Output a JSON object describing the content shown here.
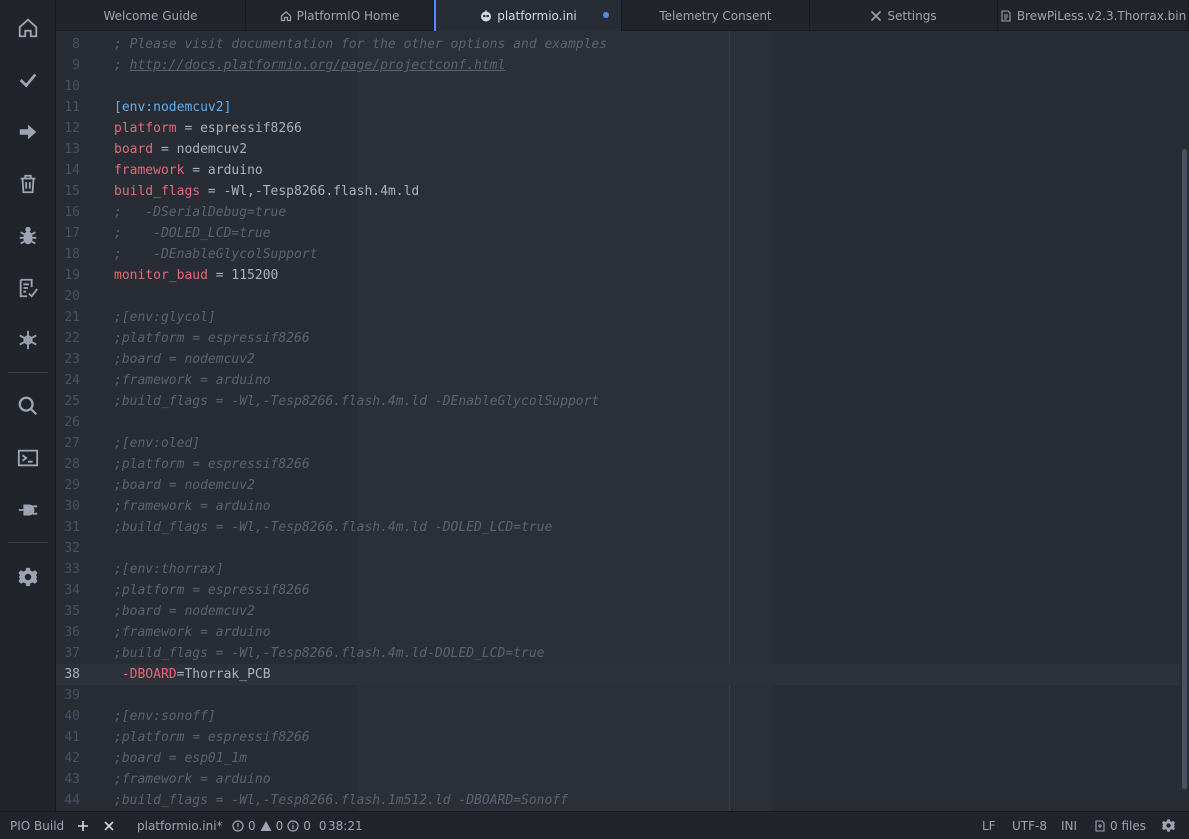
{
  "tabs": [
    {
      "label": "Welcome Guide",
      "icon": "",
      "active": false,
      "modified": false
    },
    {
      "label": "PlatformIO Home",
      "icon": "home-icon",
      "active": false,
      "modified": false
    },
    {
      "label": "platformio.ini",
      "icon": "alien-icon",
      "active": true,
      "modified": true
    },
    {
      "label": "Telemetry Consent",
      "icon": "",
      "active": false,
      "modified": false
    },
    {
      "label": "Settings",
      "icon": "tools-icon",
      "active": false,
      "modified": false
    },
    {
      "label": "BrewPiLess.v2.3.Thorrax.bin",
      "icon": "binary-file-icon",
      "active": false,
      "modified": false
    }
  ],
  "sidebar": {
    "items": [
      {
        "name": "home-icon"
      },
      {
        "name": "build-check-icon"
      },
      {
        "name": "upload-arrow-icon"
      },
      {
        "name": "clean-trash-icon"
      },
      {
        "name": "debug-bug-icon"
      },
      {
        "name": "test-checklist-icon"
      },
      {
        "name": "project-tasks-icon"
      },
      {
        "name": "search-icon"
      },
      {
        "name": "terminal-icon"
      },
      {
        "name": "serial-plug-icon"
      },
      {
        "name": "settings-gear-icon"
      }
    ]
  },
  "editor": {
    "cursor_line": 38,
    "lines": [
      {
        "n": "8",
        "parts": [
          [
            "comment",
            "; Please visit documentation for the other options and examples"
          ]
        ]
      },
      {
        "n": "9",
        "parts": [
          [
            "comment",
            "; "
          ],
          [
            "link",
            "http://docs.platformio.org/page/projectconf.html"
          ]
        ]
      },
      {
        "n": "10",
        "parts": []
      },
      {
        "n": "11",
        "parts": [
          [
            "section",
            "[env:nodemcuv2]"
          ]
        ]
      },
      {
        "n": "12",
        "parts": [
          [
            "key",
            "platform"
          ],
          [
            "text",
            " = espressif8266"
          ]
        ]
      },
      {
        "n": "13",
        "parts": [
          [
            "key",
            "board"
          ],
          [
            "text",
            " = nodemcuv2"
          ]
        ]
      },
      {
        "n": "14",
        "parts": [
          [
            "key",
            "framework"
          ],
          [
            "text",
            " = arduino"
          ]
        ]
      },
      {
        "n": "15",
        "parts": [
          [
            "key",
            "build_flags"
          ],
          [
            "text",
            " = -Wl,-Tesp8266.flash.4m.ld"
          ]
        ]
      },
      {
        "n": "16",
        "parts": [
          [
            "comment",
            ";   -DSerialDebug=true"
          ]
        ]
      },
      {
        "n": "17",
        "parts": [
          [
            "comment",
            ";    -DOLED_LCD=true"
          ]
        ]
      },
      {
        "n": "18",
        "parts": [
          [
            "comment",
            ";    -DEnableGlycolSupport"
          ]
        ]
      },
      {
        "n": "19",
        "parts": [
          [
            "key",
            "monitor_baud"
          ],
          [
            "text",
            " = 115200"
          ]
        ]
      },
      {
        "n": "20",
        "parts": []
      },
      {
        "n": "21",
        "parts": [
          [
            "comment",
            ";[env:glycol]"
          ]
        ]
      },
      {
        "n": "22",
        "parts": [
          [
            "comment",
            ";platform = espressif8266"
          ]
        ]
      },
      {
        "n": "23",
        "parts": [
          [
            "comment",
            ";board = nodemcuv2"
          ]
        ]
      },
      {
        "n": "24",
        "parts": [
          [
            "comment",
            ";framework = arduino"
          ]
        ]
      },
      {
        "n": "25",
        "parts": [
          [
            "comment",
            ";build_flags = -Wl,-Tesp8266.flash.4m.ld -DEnableGlycolSupport"
          ]
        ]
      },
      {
        "n": "26",
        "parts": []
      },
      {
        "n": "27",
        "parts": [
          [
            "comment",
            ";[env:oled]"
          ]
        ]
      },
      {
        "n": "28",
        "parts": [
          [
            "comment",
            ";platform = espressif8266"
          ]
        ]
      },
      {
        "n": "29",
        "parts": [
          [
            "comment",
            ";board = nodemcuv2"
          ]
        ]
      },
      {
        "n": "30",
        "parts": [
          [
            "comment",
            ";framework = arduino"
          ]
        ]
      },
      {
        "n": "31",
        "parts": [
          [
            "comment",
            ";build_flags = -Wl,-Tesp8266.flash.4m.ld -DOLED_LCD=true"
          ]
        ]
      },
      {
        "n": "32",
        "parts": []
      },
      {
        "n": "33",
        "parts": [
          [
            "comment",
            ";[env:thorrax]"
          ]
        ]
      },
      {
        "n": "34",
        "parts": [
          [
            "comment",
            ";platform = espressif8266"
          ]
        ]
      },
      {
        "n": "35",
        "parts": [
          [
            "comment",
            ";board = nodemcuv2"
          ]
        ]
      },
      {
        "n": "36",
        "parts": [
          [
            "comment",
            ";framework = arduino"
          ]
        ]
      },
      {
        "n": "37",
        "parts": [
          [
            "comment",
            ";build_flags = -Wl,-Tesp8266.flash.4m.ld-DOLED_LCD=true"
          ]
        ]
      },
      {
        "n": "38",
        "parts": [
          [
            "text",
            " "
          ],
          [
            "key",
            "-DBOARD"
          ],
          [
            "text",
            "=Thorrak_PCB"
          ]
        ]
      },
      {
        "n": "39",
        "parts": []
      },
      {
        "n": "40",
        "parts": [
          [
            "comment",
            ";[env:sonoff]"
          ]
        ]
      },
      {
        "n": "41",
        "parts": [
          [
            "comment",
            ";platform = espressif8266"
          ]
        ]
      },
      {
        "n": "42",
        "parts": [
          [
            "comment",
            ";board = esp01_1m"
          ]
        ]
      },
      {
        "n": "43",
        "parts": [
          [
            "comment",
            ";framework = arduino"
          ]
        ]
      },
      {
        "n": "44",
        "parts": [
          [
            "comment",
            ";build_flags = -Wl,-Tesp8266.flash.1m512.ld -DBOARD=Sonoff"
          ]
        ]
      }
    ]
  },
  "status": {
    "panel_label": "PIO Build",
    "file_name": "platformio.ini*",
    "errors": "0",
    "warnings": "0",
    "infos": "0",
    "extra_count": "0",
    "cursor_position": "38:21",
    "line_ending": "LF",
    "encoding": "UTF-8",
    "grammar": "INI",
    "changed_files": "0 files"
  },
  "colors": {
    "accent": "#568af2",
    "keyword": "#e06c75",
    "section": "#61afef",
    "comment": "#5c6370"
  }
}
